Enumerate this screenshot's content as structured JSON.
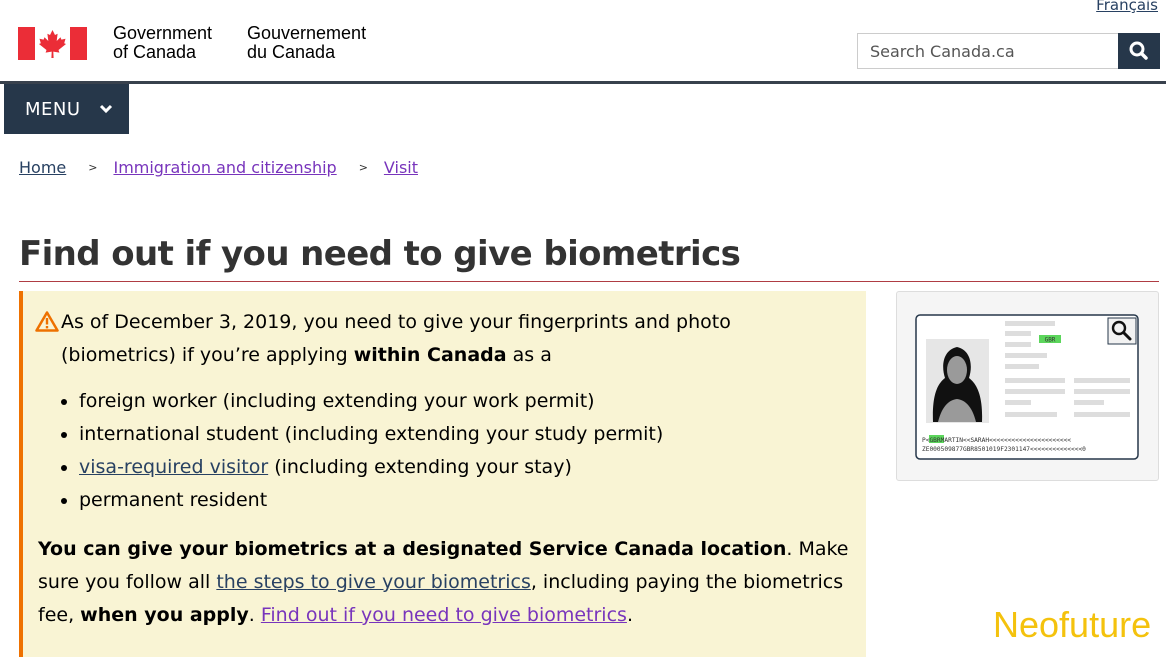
{
  "header": {
    "language_link": "Français",
    "gov_en_line1": "Government",
    "gov_en_line2": "of Canada",
    "gov_fr_line1": "Gouvernement",
    "gov_fr_line2": "du Canada",
    "search_placeholder": "Search Canada.ca",
    "flag_colors": {
      "red": "#eb2d37",
      "white": "#ffffff"
    }
  },
  "menu": {
    "label": "MENU"
  },
  "breadcrumb": [
    {
      "label": "Home"
    },
    {
      "label": "Immigration and citizenship"
    },
    {
      "label": "Visit"
    }
  ],
  "page": {
    "title": "Find out if you need to give biometrics"
  },
  "alert": {
    "intro_part1": "As of December 3, 2019, you need to give your fingerprints and photo (biometrics) if you’re applying ",
    "intro_bold": "within Canada",
    "intro_part2": " as a",
    "items": [
      {
        "text": "foreign worker (including extending your work permit)"
      },
      {
        "text": "international student (including extending your study permit)"
      },
      {
        "link": "visa-required visitor",
        "text": " (including extending your stay)"
      },
      {
        "text": "permanent resident"
      }
    ],
    "p2_bold1": "You can give your biometrics at a designated Service Canada location",
    "p2_text1": ". Make sure you follow all ",
    "p2_link1": "the steps to give your biometrics",
    "p2_text2": ", including paying the biometrics fee, ",
    "p2_bold2": "when you apply",
    "p2_text3": ". ",
    "p2_link2": "Find out if you need to give biometrics",
    "p2_text4": "."
  },
  "passport_card": {
    "code_label": "GBR",
    "mrz_line1_prefix": "P<",
    "mrz_line1_code": "GBR",
    "mrz_line1_rest": "MARTIN<<SARAH<<<<<<<<<<<<<<<<<<<<<<",
    "mrz_line2": "ZE000509877GBR8501019F2301147<<<<<<<<<<<<<<0"
  },
  "watermark": "Neofuture",
  "colors": {
    "nav_dark": "#26374a",
    "link": "#284162",
    "visited_link": "#7834bc",
    "alert_bg": "#f9f4d4",
    "alert_border": "#ee7100",
    "title_rule": "#af3c43"
  }
}
